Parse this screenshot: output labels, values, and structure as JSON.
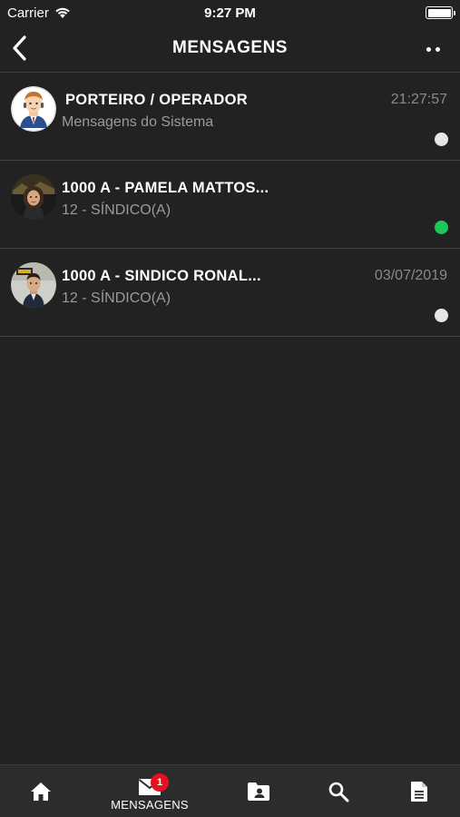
{
  "status_bar": {
    "carrier": "Carrier",
    "time": "9:27 PM"
  },
  "header": {
    "title": "MENSAGENS"
  },
  "conversations": [
    {
      "title": "PORTEIRO / OPERADOR",
      "subtitle": "Mensagens do Sistema",
      "time": "21:27:57",
      "status_color": "#e6e6e6"
    },
    {
      "title": "1000 A - PAMELA MATTOS...",
      "subtitle": "12 - SÍNDICO(A)",
      "time": "",
      "status_color": "#1fc65a"
    },
    {
      "title": "1000 A - SINDICO RONAL...",
      "subtitle": "12 - SÍNDICO(A)",
      "time": "03/07/2019",
      "status_color": "#e6e6e6"
    }
  ],
  "tabbar": {
    "messages_label": "MENSAGENS",
    "messages_badge": "1",
    "icons": [
      "home-icon",
      "mail-icon",
      "contacts-folder-icon",
      "search-icon",
      "document-icon"
    ]
  },
  "colors": {
    "background": "#222222",
    "online": "#1fc65a",
    "offline": "#e6e6e6",
    "badge": "#e8101e"
  }
}
